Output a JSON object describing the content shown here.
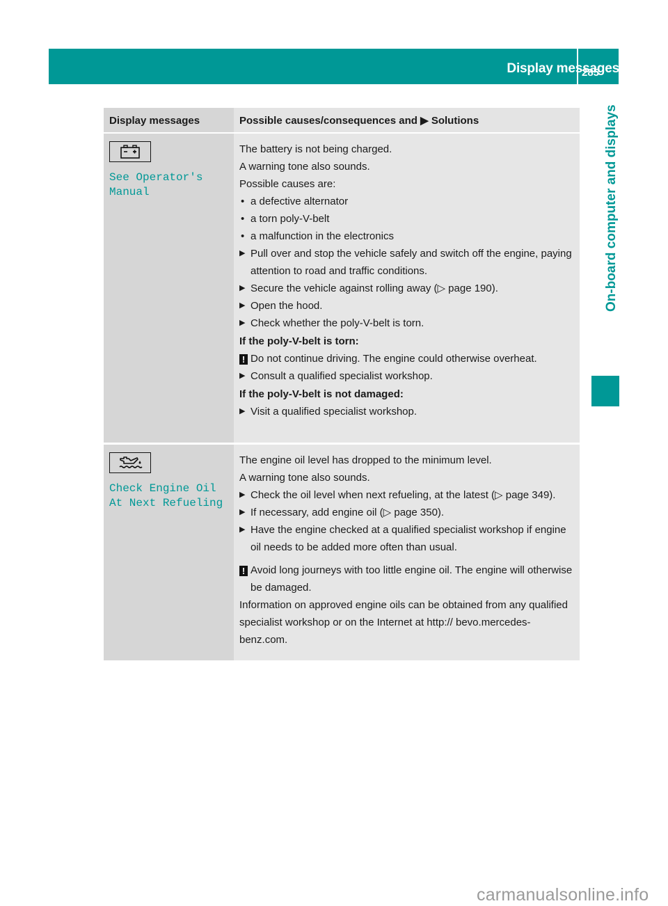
{
  "header": {
    "section_title": "Display messages",
    "page_number": "285",
    "chapter_tab": "On-board computer and displays",
    "accent_color": "#009896"
  },
  "table": {
    "columns": [
      "Display messages",
      "Possible causes/consequences and",
      "Solutions"
    ],
    "rows": [
      {
        "icon": "battery-icon",
        "display_text_line1": "See Operator's",
        "display_text_line2": "Manual",
        "content": {
          "intro1": "The battery is not being charged.",
          "intro2": "A warning tone also sounds.",
          "intro3": "Possible causes are:",
          "causes": [
            "a defective alternator",
            "a torn poly-V-belt",
            "a malfunction in the electronics"
          ],
          "steps": [
            "Pull over and stop the vehicle safely and switch off the engine, paying attention to road and traffic conditions.",
            "Secure the vehicle against rolling away (▷ page 190).",
            "Open the hood.",
            "Check whether the poly-V-belt is torn."
          ],
          "torn_heading": "If the poly-V-belt is torn:",
          "torn_warning": "Do not continue driving. The engine could otherwise overheat.",
          "torn_step": "Consult a qualified specialist workshop.",
          "not_damaged_heading": "If the poly-V-belt is not damaged:",
          "not_damaged_step": "Visit a qualified specialist workshop."
        }
      },
      {
        "icon": "oil-can-icon",
        "display_text_line1": "Check Engine Oil",
        "display_text_line2": "At Next Refueling",
        "content": {
          "intro1": "The engine oil level has dropped to the minimum level.",
          "intro2": "A warning tone also sounds.",
          "steps": [
            "Check the oil level when next refueling, at the latest (▷ page 349).",
            "If necessary, add engine oil (▷ page 350).",
            "Have the engine checked at a qualified specialist workshop if engine oil needs to be added more often than usual."
          ],
          "warning": "Avoid long journeys with too little engine oil. The engine will otherwise be damaged.",
          "info": "Information on approved engine oils can be obtained from any qualified specialist workshop or on the Internet at http:// bevo.mercedes-benz.com."
        }
      }
    ]
  },
  "symbols": {
    "step_arrow": "▶",
    "bullet": "•",
    "warning_mark": "!"
  },
  "watermark": "carmanualsonline.info"
}
